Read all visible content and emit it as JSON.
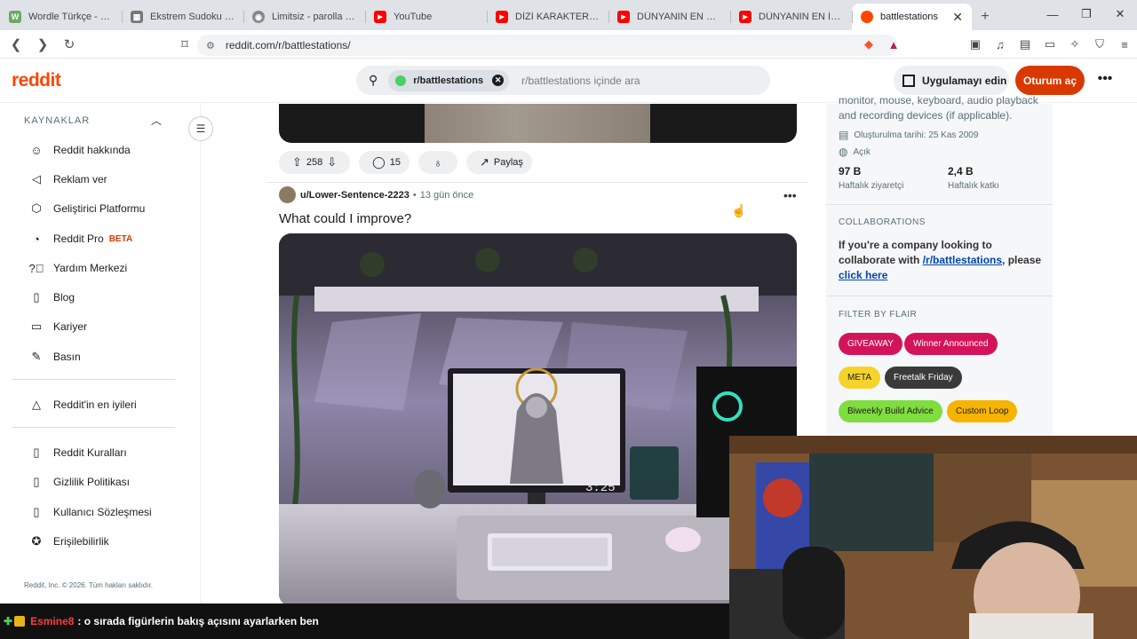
{
  "browser": {
    "tabs": [
      {
        "title": "Wordle Türkçe - Günl",
        "fav_color": "#6aaa64",
        "fav_text": "W"
      },
      {
        "title": "Ekstrem Sudoku - Üc",
        "fav_color": "#777777",
        "fav_text": "▦"
      },
      {
        "title": "Limitsiz - parolla - Ke",
        "fav_color": "#888888",
        "fav_text": "◉"
      },
      {
        "title": "YouTube",
        "fav_color": "#ff0000",
        "fav_text": "▶"
      },
      {
        "title": "DİZİ KARAKTERLERİNİ",
        "fav_color": "#ff0000",
        "fav_text": "▶"
      },
      {
        "title": "DÜNYANIN EN PAHA",
        "fav_color": "#ff0000",
        "fav_text": "▶"
      },
      {
        "title": "DÜNYANIN EN İYİ AR",
        "fav_color": "#ff0000",
        "fav_text": "▶"
      }
    ],
    "active_tab": {
      "title": "battlestations",
      "close": "✕"
    },
    "new_tab": "+",
    "url": "reddit.com/r/battlestations/"
  },
  "header": {
    "logo": "reddit",
    "search_chip": "r/battlestations",
    "search_placeholder": "r/battlestations içinde ara",
    "app_button": "Uygulamayı edin",
    "login_button": "Oturum aç",
    "more": "•••"
  },
  "sidebar": {
    "section": "KAYNAKLAR",
    "items": [
      {
        "label": "Reddit hakkında",
        "icon": "reddit-alien-icon"
      },
      {
        "label": "Reklam ver",
        "icon": "megaphone-icon"
      },
      {
        "label": "Geliştirici Platformu",
        "icon": "developer-icon"
      },
      {
        "label": "Reddit Pro",
        "icon": "pro-icon",
        "badge": "BETA"
      },
      {
        "label": "Yardım Merkezi",
        "icon": "help-icon"
      },
      {
        "label": "Blog",
        "icon": "book-icon"
      },
      {
        "label": "Kariyer",
        "icon": "briefcase-icon"
      },
      {
        "label": "Basın",
        "icon": "microphone-icon"
      }
    ],
    "best": "Reddit'in en iyileri",
    "legal": [
      {
        "label": "Reddit Kuralları"
      },
      {
        "label": "Gizlilik Politikası"
      },
      {
        "label": "Kullanıcı Sözleşmesi"
      },
      {
        "label": "Erişilebilirlik"
      }
    ],
    "copyright": "Reddit, Inc. © 2026. Tüm hakları saklıdır."
  },
  "feed": {
    "prev_post": {
      "votes": "258",
      "comments": "15",
      "share": "Paylaş"
    },
    "post": {
      "user": "u/Lower-Sentence-2223",
      "age": "13 gün önce",
      "title": "What could I improve?"
    }
  },
  "right": {
    "desc_fragment": "monitor, mouse, keyboard, audio playback and recording devices (if applicable).",
    "created": "Oluşturulma tarihi: 25 Kas 2009",
    "visibility": "Açık",
    "stats": [
      {
        "value": "97 B",
        "label": "Haftalık ziyaretçi"
      },
      {
        "value": "2,4 B",
        "label": "Haftalık katkı"
      }
    ],
    "collab_head": "COLLABORATIONS",
    "collab_text_1": "If you're a company looking to collaborate with ",
    "collab_link": "/r/battlestations",
    "collab_text_2": ", please ",
    "collab_link2": "click here",
    "flair_head": "FILTER BY FLAIR",
    "flairs": [
      {
        "label": "GIVEAWAY",
        "bg": "#d4145a",
        "fg": "#ffffff"
      },
      {
        "label": "Winner Announced",
        "bg": "#d4145a",
        "fg": "#ffffff"
      },
      {
        "label": "META",
        "bg": "#f5d32b",
        "fg": "#1c1c1c"
      },
      {
        "label": "Freetalk Friday",
        "bg": "#3a3a3a",
        "fg": "#ffffff"
      },
      {
        "label": "Biweekly Build Advice",
        "bg": "#7fdd3f",
        "fg": "#1c1c1c"
      },
      {
        "label": "Custom Loop",
        "bg": "#f5b400",
        "fg": "#1c1c1c"
      }
    ]
  },
  "chat": {
    "user": "Esmine8",
    "message": ": o sırada figürlerin bakış açısını ayarlarken ben"
  }
}
